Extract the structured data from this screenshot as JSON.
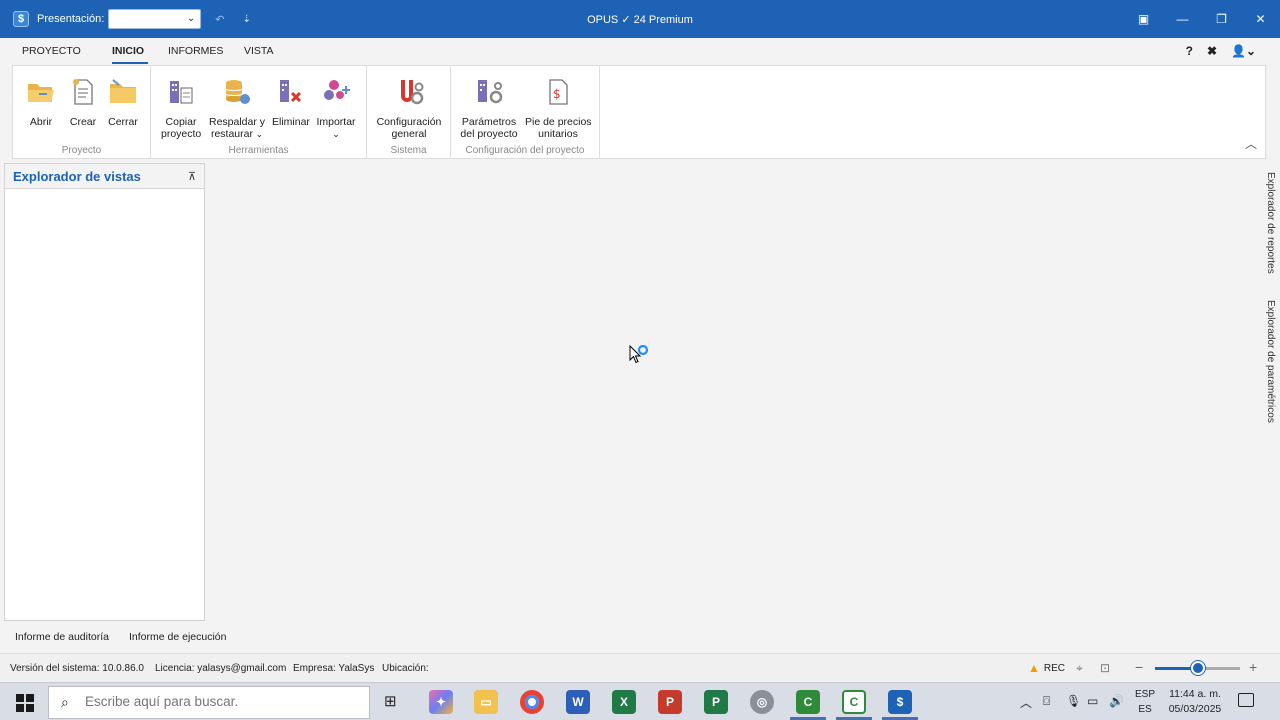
{
  "titlebar": {
    "presentation_label": "Presentación:",
    "presentation_value": "",
    "app_title": "OPUS ✓ 24 Premium"
  },
  "ribbon_tabs": [
    "PROYECTO",
    "INICIO",
    "INFORMES",
    "VISTA"
  ],
  "active_tab": "INICIO",
  "ribbon": {
    "groups": [
      {
        "label": "Proyecto",
        "buttons": [
          "Abrir",
          "Crear",
          "Cerrar"
        ]
      },
      {
        "label": "Herramientas",
        "buttons": [
          "Copiar\nproyecto",
          "Respaldar y\nrestaurar",
          "Eliminar",
          "Importar"
        ]
      },
      {
        "label": "Sistema",
        "buttons": [
          "Configuración\ngeneral"
        ]
      },
      {
        "label": "Configuración del proyecto",
        "buttons": [
          "Parámetros\ndel proyecto",
          "Pie de precios\nunitarios"
        ]
      }
    ]
  },
  "explorer": {
    "title": "Explorador de vistas"
  },
  "side_tabs": [
    "Explorador de reportes",
    "Explorador de paramétricos"
  ],
  "report_tabs": [
    "Informe de auditoría",
    "Informe de ejecución"
  ],
  "statusbar": {
    "version": "Versión del sistema: 10.0.86.0",
    "license": "Licencia: yalasys@gmail.com",
    "company": "Empresa: YalaSys",
    "location": "Ubicación:",
    "rec": "REC",
    "zoom_fraction": 0.5
  },
  "taskbar": {
    "search_placeholder": "Escribe aquí para buscar.",
    "lang_top": "ESP",
    "lang_bottom": "ES",
    "time": "11:44 a. m.",
    "date": "05/03/2025"
  },
  "colors": {
    "accent": "#1d62b5",
    "warning": "#e8a100"
  }
}
